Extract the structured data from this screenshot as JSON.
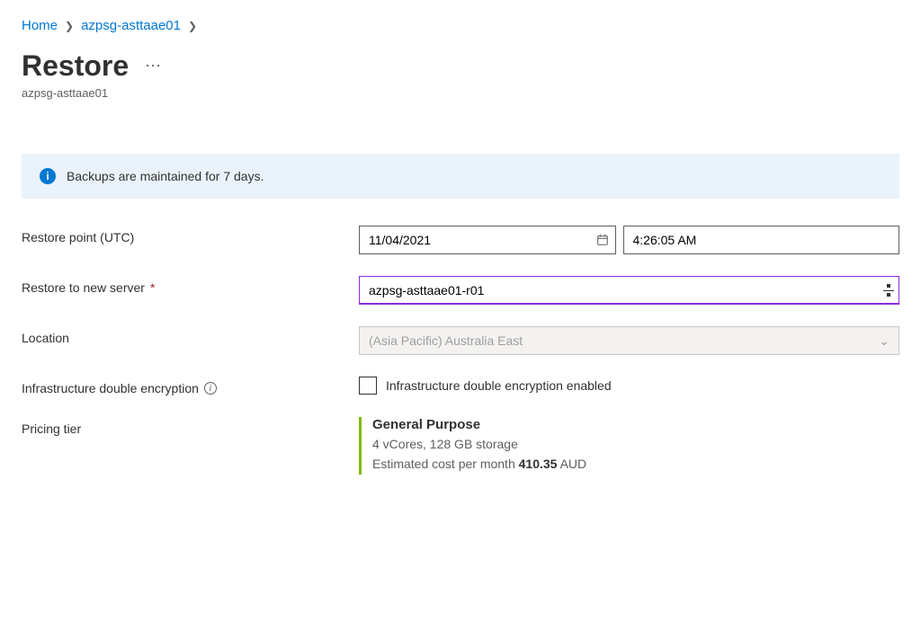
{
  "breadcrumb": {
    "home": "Home",
    "resource": "azpsg-asttaae01"
  },
  "header": {
    "title": "Restore",
    "subtitle": "azpsg-asttaae01"
  },
  "info_banner": {
    "message": "Backups are maintained for 7 days."
  },
  "form": {
    "restore_point_label": "Restore point (UTC)",
    "restore_date": "11/04/2021",
    "restore_time": "4:26:05 AM",
    "new_server_label": "Restore to new server",
    "new_server_value": "azpsg-asttaae01-r01",
    "location_label": "Location",
    "location_value": "(Asia Pacific) Australia East",
    "encryption_label": "Infrastructure double encryption",
    "encryption_checkbox_label": "Infrastructure double encryption enabled",
    "pricing_label": "Pricing tier",
    "pricing": {
      "title": "General Purpose",
      "specs": "4 vCores, 128 GB storage",
      "cost_prefix": "Estimated cost per month ",
      "cost_amount": "410.35",
      "cost_suffix": " AUD"
    }
  }
}
